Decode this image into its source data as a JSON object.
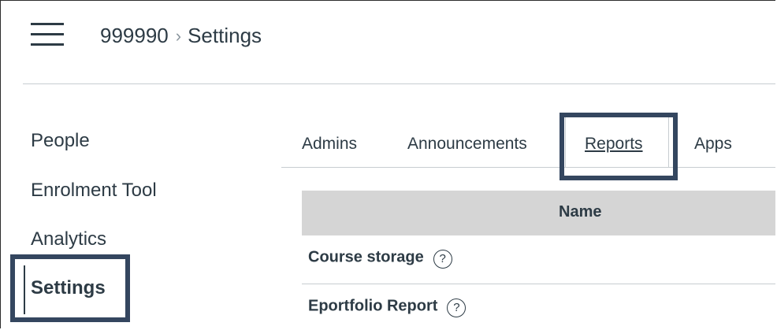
{
  "header": {
    "menu_icon": "hamburger-icon",
    "breadcrumb": {
      "course": "999990",
      "separator": "›",
      "page": "Settings"
    }
  },
  "course_nav": {
    "items": [
      {
        "label": "People",
        "active": false
      },
      {
        "label": "Enrolment Tool",
        "active": false
      },
      {
        "label": "Analytics",
        "active": false
      },
      {
        "label": "Settings",
        "active": true
      }
    ]
  },
  "tabs": [
    {
      "label": "Admins",
      "active": false
    },
    {
      "label": "Announcements",
      "active": false
    },
    {
      "label": "Reports",
      "active": true
    },
    {
      "label": "Apps",
      "active": false
    }
  ],
  "reports_table": {
    "columns": [
      "Name"
    ],
    "rows": [
      {
        "name": "Course storage",
        "help_icon": "?"
      },
      {
        "name": "Eportfolio Report",
        "help_icon": "?"
      }
    ]
  },
  "colors": {
    "text": "#2d3b45",
    "highlight_border": "#34465f",
    "table_header_bg": "#d5d5d5",
    "divider": "#c7cdd1"
  }
}
